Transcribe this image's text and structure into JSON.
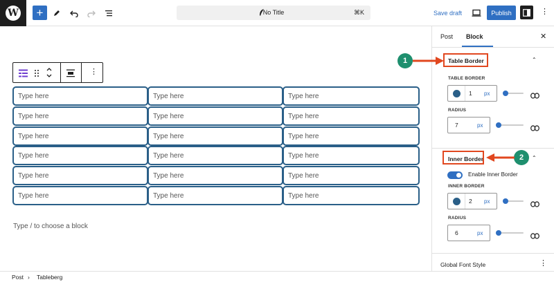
{
  "topbar": {
    "doc_title": "No Title",
    "shortcut": "⌘K",
    "save_draft": "Save draft",
    "publish": "Publish",
    "add_symbol": "+"
  },
  "table": {
    "rows": [
      [
        "Type here",
        "Type here",
        "Type here"
      ],
      [
        "Type here",
        "Type here",
        "Type here"
      ],
      [
        "Type here",
        "Type here",
        "Type here"
      ],
      [
        "Type here",
        "Type here",
        "Type here"
      ],
      [
        "Type here",
        "Type here",
        "Type here"
      ],
      [
        "Type here",
        "Type here",
        "Type here"
      ]
    ],
    "border_color": "#2a5f88"
  },
  "editor": {
    "block_placeholder": "Type / to choose a block"
  },
  "sidebar": {
    "tabs": [
      "Post",
      "Block"
    ],
    "active_tab": "Block",
    "table_border": {
      "title": "Table Border",
      "border_label": "TABLE BORDER",
      "border_value": "1",
      "border_unit": "px",
      "radius_label": "RADIUS",
      "radius_value": "7",
      "radius_unit": "px"
    },
    "inner_border": {
      "title": "Inner Border",
      "toggle_label": "Enable Inner Border",
      "toggle_on": true,
      "border_label": "INNER BORDER",
      "border_value": "2",
      "border_unit": "px",
      "radius_label": "RADIUS",
      "radius_value": "6",
      "radius_unit": "px"
    },
    "global_font": "Global Font Style"
  },
  "annotations": {
    "badge_1": "1",
    "badge_2": "2",
    "highlight_color": "#e1471f",
    "badge_color": "#1e8f6e"
  },
  "footer": {
    "crumbs": [
      "Post",
      "Tableberg"
    ]
  },
  "colors": {
    "accent": "#2f6fc2",
    "dark": "#1e1e1e"
  }
}
